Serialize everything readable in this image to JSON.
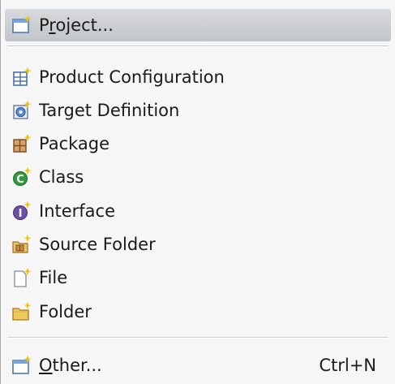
{
  "menu": {
    "project": {
      "pre": "P",
      "mnemonic": "r",
      "post": "oject...",
      "icon": "new-project-icon"
    },
    "items": [
      {
        "label": "Product Configuration",
        "icon": "product-configuration-icon"
      },
      {
        "label": "Target Definition",
        "icon": "target-definition-icon"
      },
      {
        "label": "Package",
        "icon": "package-icon"
      },
      {
        "label": "Class",
        "icon": "class-icon"
      },
      {
        "label": "Interface",
        "icon": "interface-icon"
      },
      {
        "label": "Source Folder",
        "icon": "source-folder-icon"
      },
      {
        "label": "File",
        "icon": "file-icon"
      },
      {
        "label": "Folder",
        "icon": "folder-icon"
      }
    ],
    "other": {
      "mnemonic": "O",
      "post": "ther...",
      "shortcut": "Ctrl+N",
      "icon": "other-wizard-icon"
    }
  },
  "colors": {
    "highlight": "#c8cbcf",
    "sparkle": "#f2c200",
    "class_green": "#2e9a3a",
    "interface_purple": "#6b4fa8"
  }
}
